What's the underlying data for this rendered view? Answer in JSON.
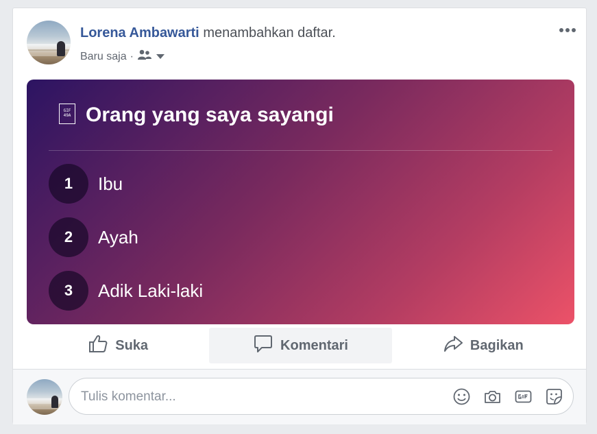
{
  "post": {
    "author": "Lorena Ambawarti",
    "action": "menambahkan daftar.",
    "timestamp": "Baru saja",
    "separator": "·",
    "privacy_icon": "friends-icon"
  },
  "list": {
    "title": "Orang yang saya sayangi",
    "icon_text": "GIF 49A",
    "items": [
      {
        "number": "1",
        "label": "Ibu"
      },
      {
        "number": "2",
        "label": "Ayah"
      },
      {
        "number": "3",
        "label": "Adik Laki-laki"
      }
    ]
  },
  "actions": {
    "like": "Suka",
    "comment": "Komentari",
    "share": "Bagikan"
  },
  "composer": {
    "placeholder": "Tulis komentar...",
    "icons": [
      "emoji-icon",
      "camera-icon",
      "gif-icon",
      "sticker-icon"
    ]
  },
  "colors": {
    "author_link": "#365899",
    "gradient_start": "#2c1462",
    "gradient_end": "#ec5268"
  }
}
